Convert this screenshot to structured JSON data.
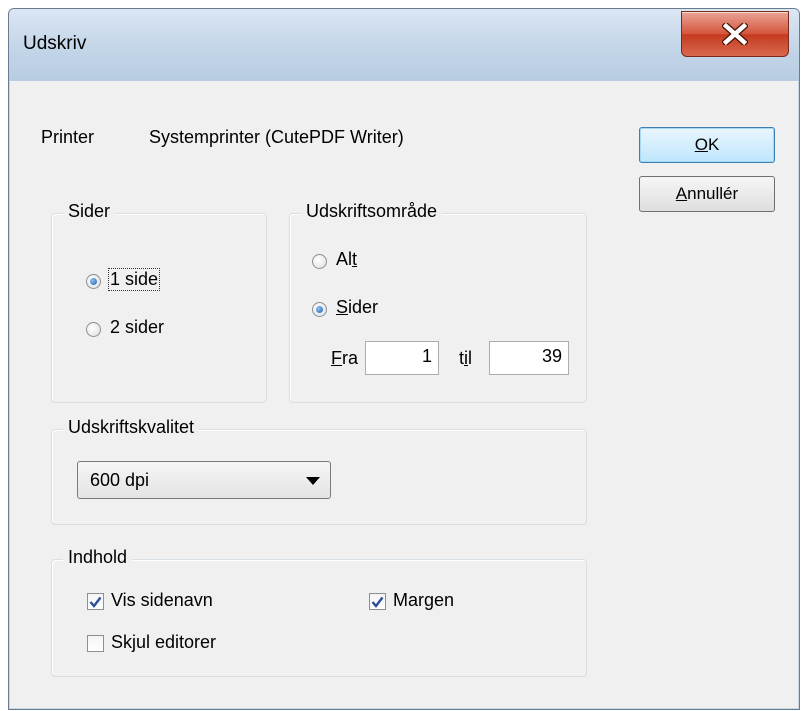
{
  "window": {
    "title": "Udskriv",
    "close_icon": "close-x-icon",
    "close_color": "#c43a1f"
  },
  "printer": {
    "label": "Printer",
    "value": "Systemprinter (CutePDF Writer)"
  },
  "buttons": {
    "ok": {
      "accel": "O",
      "rest": "K"
    },
    "cancel": {
      "accel": "A",
      "rest": "nnullér"
    }
  },
  "pages_group": {
    "legend": "Sider",
    "options": [
      {
        "label": "1 side",
        "selected": true
      },
      {
        "label": "2 sider",
        "selected": false
      }
    ]
  },
  "range_group": {
    "legend": "Udskriftsområde",
    "all": {
      "pre": "Al",
      "accel": "t",
      "post": "",
      "selected": false
    },
    "pages": {
      "pre": "",
      "accel": "S",
      "post": "ider",
      "selected": true
    },
    "from": {
      "accel": "F",
      "rest": "ra",
      "value": "1"
    },
    "to": {
      "pre": "t",
      "accel": "i",
      "post": "l",
      "value": "39"
    }
  },
  "quality_group": {
    "legend": "Udskriftskvalitet",
    "selected": "600 dpi"
  },
  "content_group": {
    "legend": "Indhold",
    "show_page_names": {
      "label": "Vis sidenavn",
      "checked": true
    },
    "margin": {
      "label": "Margen",
      "checked": true
    },
    "hide_editors": {
      "label": "Skjul editorer",
      "checked": false
    }
  }
}
